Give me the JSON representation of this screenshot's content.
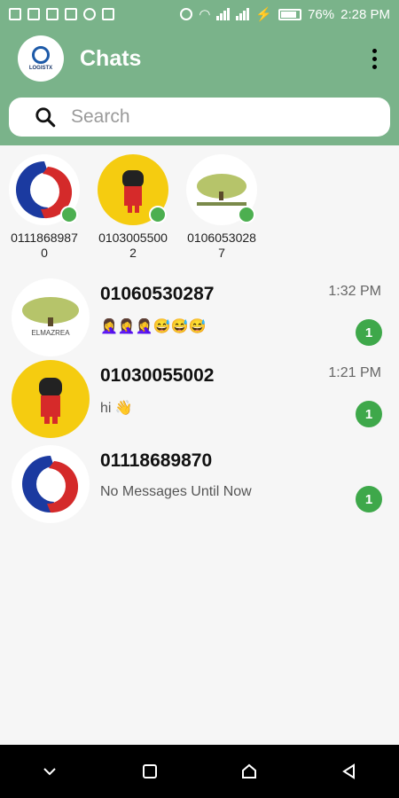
{
  "status_bar": {
    "battery": "76%",
    "time": "2:28 PM"
  },
  "header": {
    "title": "Chats",
    "logo_text": "LOGISTX"
  },
  "search": {
    "placeholder": "Search"
  },
  "stories": [
    {
      "number": "01118689870",
      "online": true,
      "avatar": "swirl-logo"
    },
    {
      "number": "01030055002",
      "online": true,
      "avatar": "bear-illustration"
    },
    {
      "number": "01060530287",
      "online": true,
      "avatar": "elmazrea-tree"
    }
  ],
  "chats": [
    {
      "name": "01060530287",
      "time": "1:32 PM",
      "message": "🤦‍♀️🤦‍♀️🤦‍♀️😅😅😅",
      "unread": "1",
      "avatar": "elmazrea-tree",
      "avatar_text": "ELMAZREA"
    },
    {
      "name": "01030055002",
      "time": "1:21 PM",
      "message": "hi 👋",
      "unread": "1",
      "avatar": "bear-illustration"
    },
    {
      "name": "01118689870",
      "time": "",
      "message": "No Messages Until Now",
      "unread": "1",
      "avatar": "swirl-logo"
    }
  ],
  "colors": {
    "header": "#7ab38a",
    "online": "#4caf50",
    "badge": "#3ea84a"
  }
}
